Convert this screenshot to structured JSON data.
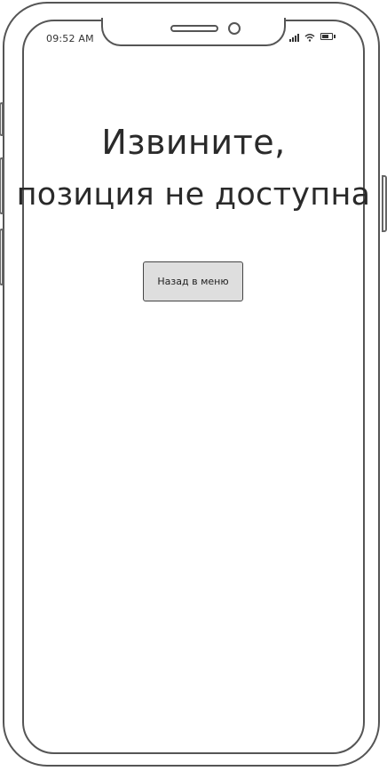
{
  "status_bar": {
    "time": "09:52 AM",
    "icons": [
      "signal-icon",
      "wifi-icon",
      "battery-icon"
    ]
  },
  "message": {
    "line1": "Извините,",
    "line2": "позиция не доступна"
  },
  "actions": {
    "back_label": "Назад в меню"
  }
}
